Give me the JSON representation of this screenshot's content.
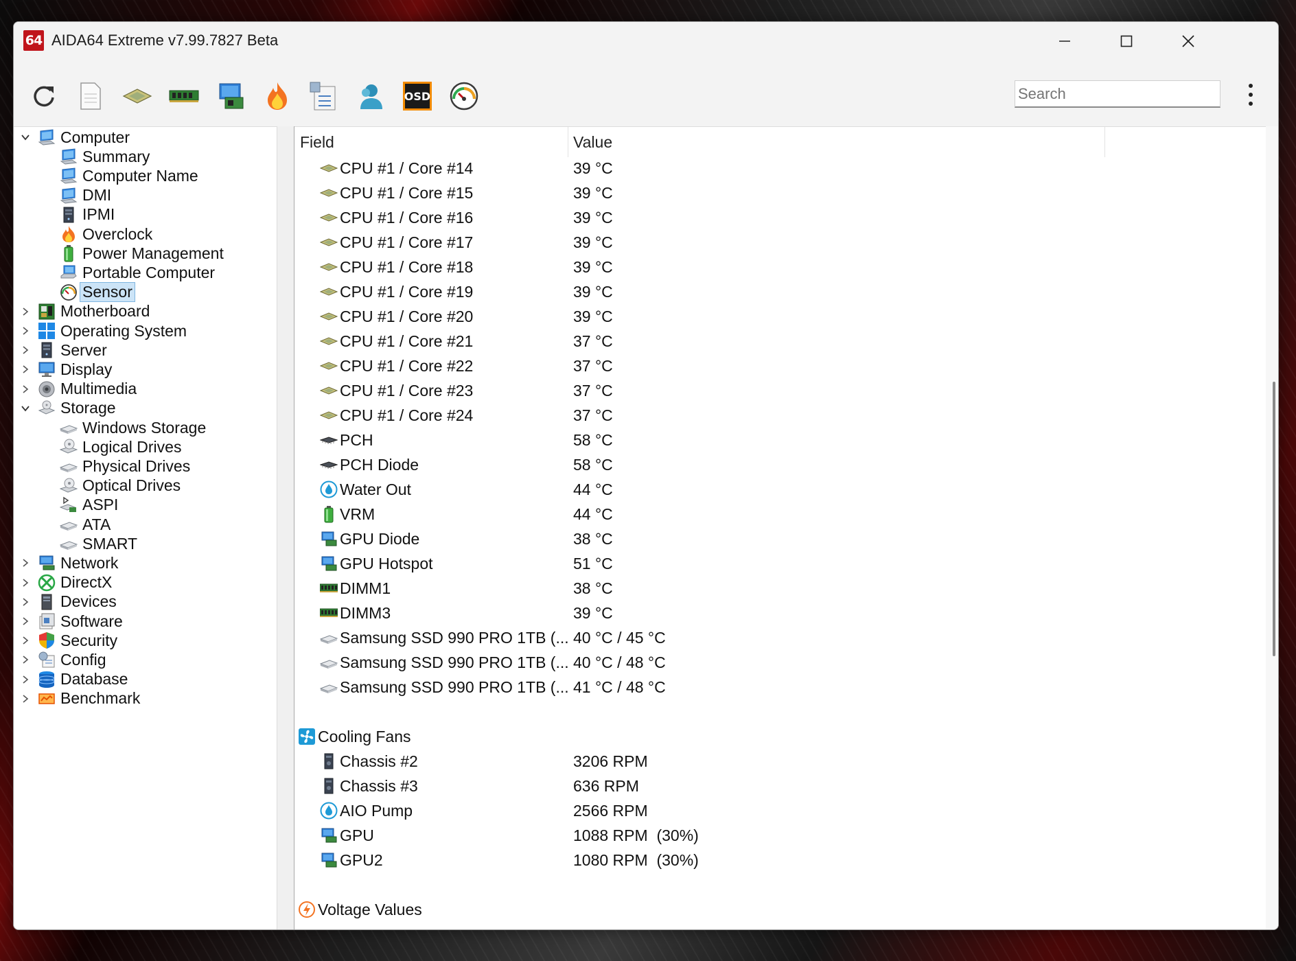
{
  "window": {
    "app_logo": "64",
    "title": "AIDA64 Extreme v7.99.7827 Beta",
    "minimize_label": "—",
    "maximize_label": "☐",
    "close_label": "✕"
  },
  "toolbar": {
    "search_placeholder": "Search",
    "osd_label": "OSD",
    "icons": [
      "refresh-icon",
      "report-icon",
      "cpu-icon",
      "memory-icon",
      "motherboard-icon",
      "flame-icon",
      "tasks-icon",
      "user-icon",
      "osd-icon",
      "sensor-gauge-icon"
    ]
  },
  "tree": {
    "items": [
      {
        "label": "Computer",
        "icon": "computer-icon",
        "expanded": true
      },
      {
        "label": "Summary",
        "icon": "computer-icon"
      },
      {
        "label": "Computer Name",
        "icon": "computer-icon"
      },
      {
        "label": "DMI",
        "icon": "computer-icon"
      },
      {
        "label": "IPMI",
        "icon": "server-icon"
      },
      {
        "label": "Overclock",
        "icon": "flame-icon"
      },
      {
        "label": "Power Management",
        "icon": "battery-icon"
      },
      {
        "label": "Portable Computer",
        "icon": "laptop-icon"
      },
      {
        "label": "Sensor",
        "icon": "sensor-gauge-icon",
        "selected": true
      },
      {
        "label": "Motherboard",
        "icon": "motherboard-icon"
      },
      {
        "label": "Operating System",
        "icon": "windows-icon"
      },
      {
        "label": "Server",
        "icon": "server-icon"
      },
      {
        "label": "Display",
        "icon": "display-icon"
      },
      {
        "label": "Multimedia",
        "icon": "speaker-icon"
      },
      {
        "label": "Storage",
        "icon": "storage-icon",
        "expanded": true
      },
      {
        "label": "Windows Storage",
        "icon": "drive-icon"
      },
      {
        "label": "Logical Drives",
        "icon": "disc-drive-icon"
      },
      {
        "label": "Physical Drives",
        "icon": "drive-icon"
      },
      {
        "label": "Optical Drives",
        "icon": "disc-drive-icon"
      },
      {
        "label": "ASPI",
        "icon": "aspi-icon"
      },
      {
        "label": "ATA",
        "icon": "drive-icon"
      },
      {
        "label": "SMART",
        "icon": "drive-icon"
      },
      {
        "label": "Network",
        "icon": "network-icon"
      },
      {
        "label": "DirectX",
        "icon": "xbox-icon"
      },
      {
        "label": "Devices",
        "icon": "devices-icon"
      },
      {
        "label": "Software",
        "icon": "software-icon"
      },
      {
        "label": "Security",
        "icon": "shield-icon"
      },
      {
        "label": "Config",
        "icon": "config-icon"
      },
      {
        "label": "Database",
        "icon": "database-icon"
      },
      {
        "label": "Benchmark",
        "icon": "benchmark-icon"
      }
    ]
  },
  "list": {
    "columns": {
      "field": "Field",
      "value": "Value"
    },
    "rows": [
      {
        "field": "CPU #1 / Core #14",
        "value": "39 °C",
        "icon": "cpu-icon"
      },
      {
        "field": "CPU #1 / Core #15",
        "value": "39 °C",
        "icon": "cpu-icon"
      },
      {
        "field": "CPU #1 / Core #16",
        "value": "39 °C",
        "icon": "cpu-icon"
      },
      {
        "field": "CPU #1 / Core #17",
        "value": "39 °C",
        "icon": "cpu-icon"
      },
      {
        "field": "CPU #1 / Core #18",
        "value": "39 °C",
        "icon": "cpu-icon"
      },
      {
        "field": "CPU #1 / Core #19",
        "value": "39 °C",
        "icon": "cpu-icon"
      },
      {
        "field": "CPU #1 / Core #20",
        "value": "39 °C",
        "icon": "cpu-icon"
      },
      {
        "field": "CPU #1 / Core #21",
        "value": "37 °C",
        "icon": "cpu-icon"
      },
      {
        "field": "CPU #1 / Core #22",
        "value": "37 °C",
        "icon": "cpu-icon"
      },
      {
        "field": "CPU #1 / Core #23",
        "value": "37 °C",
        "icon": "cpu-icon"
      },
      {
        "field": "CPU #1 / Core #24",
        "value": "37 °C",
        "icon": "cpu-icon"
      },
      {
        "field": "PCH",
        "value": "58 °C",
        "icon": "chip-icon"
      },
      {
        "field": "PCH Diode",
        "value": "58 °C",
        "icon": "chip-icon"
      },
      {
        "field": "Water Out",
        "value": "44 °C",
        "icon": "water-drop-icon"
      },
      {
        "field": "VRM",
        "value": "44 °C",
        "icon": "battery-icon"
      },
      {
        "field": "GPU Diode",
        "value": "38 °C",
        "icon": "gpu-icon"
      },
      {
        "field": "GPU Hotspot",
        "value": "51 °C",
        "icon": "gpu-icon"
      },
      {
        "field": "DIMM1",
        "value": "38 °C",
        "icon": "memory-icon"
      },
      {
        "field": "DIMM3",
        "value": "39 °C",
        "icon": "memory-icon"
      },
      {
        "field": "Samsung SSD 990 PRO 1TB (...",
        "value": "40 °C / 45 °C",
        "icon": "drive-icon"
      },
      {
        "field": "Samsung SSD 990 PRO 1TB (...",
        "value": "40 °C / 48 °C",
        "icon": "drive-icon"
      },
      {
        "field": "Samsung SSD 990 PRO 1TB (...",
        "value": "41 °C / 48 °C",
        "icon": "drive-icon"
      }
    ],
    "fans_group": "Cooling Fans",
    "fans": [
      {
        "field": "Chassis #2",
        "value": "3206 RPM",
        "icon": "chassis-icon"
      },
      {
        "field": "Chassis #3",
        "value": "636 RPM",
        "icon": "chassis-icon"
      },
      {
        "field": "AIO Pump",
        "value": "2566 RPM",
        "icon": "water-drop-icon"
      },
      {
        "field": "GPU",
        "value": "1088 RPM  (30%)",
        "icon": "gpu-icon"
      },
      {
        "field": "GPU2",
        "value": "1080 RPM  (30%)",
        "icon": "gpu-icon"
      }
    ],
    "voltage_group": "Voltage Values"
  }
}
